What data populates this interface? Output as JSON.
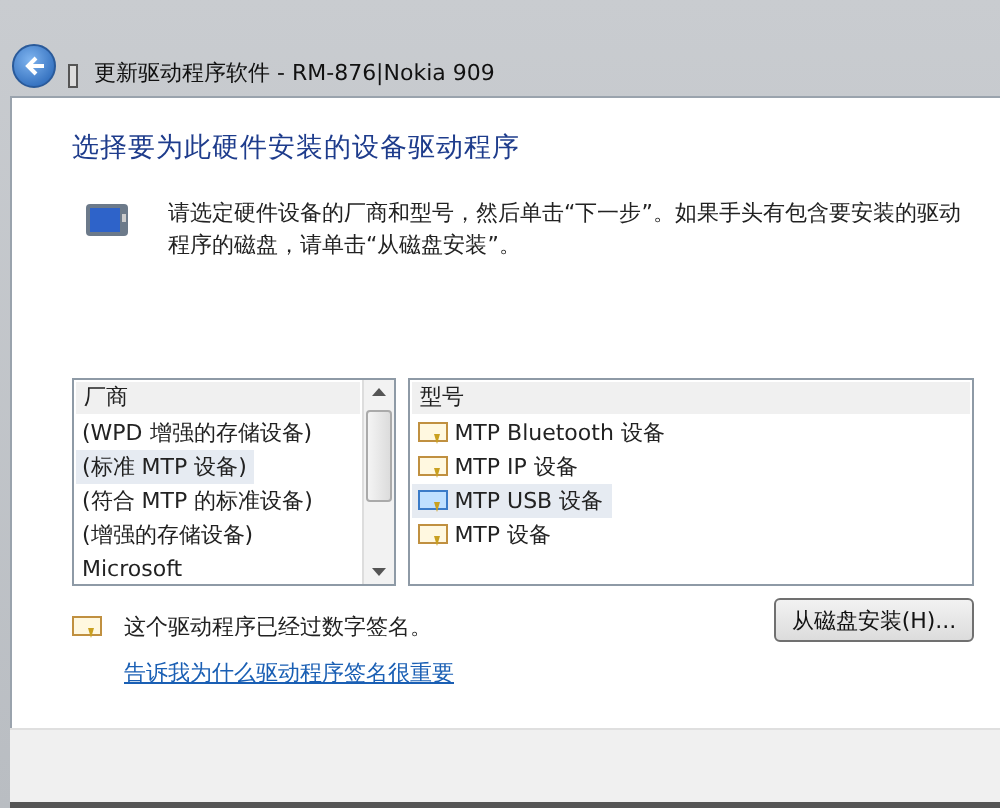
{
  "window": {
    "title": "更新驱动程序软件 - RM-876|Nokia 909"
  },
  "heading": "选择要为此硬件安装的设备驱动程序",
  "description": "请选定硬件设备的厂商和型号，然后单击“下一步”。如果手头有包含要安装的驱动程序的磁盘，请单击“从磁盘安装”。",
  "manufacturers": {
    "header": "厂商",
    "items": [
      {
        "label": "(WPD 增强的存储设备)",
        "selected": false
      },
      {
        "label": "(标准 MTP 设备)",
        "selected": true
      },
      {
        "label": "(符合 MTP 的标准设备)",
        "selected": false
      },
      {
        "label": "(增强的存储设备)",
        "selected": false
      },
      {
        "label": "Microsoft",
        "selected": false
      }
    ]
  },
  "models": {
    "header": "型号",
    "items": [
      {
        "label": "MTP Bluetooth 设备",
        "selected": false
      },
      {
        "label": "MTP IP 设备",
        "selected": false
      },
      {
        "label": "MTP USB 设备",
        "selected": true
      },
      {
        "label": "MTP 设备",
        "selected": false
      }
    ]
  },
  "signature_note": "这个驱动程序已经过数字签名。",
  "signature_link": "告诉我为什么驱动程序签名很重要",
  "have_disk_button": "从磁盘安装(H)..."
}
